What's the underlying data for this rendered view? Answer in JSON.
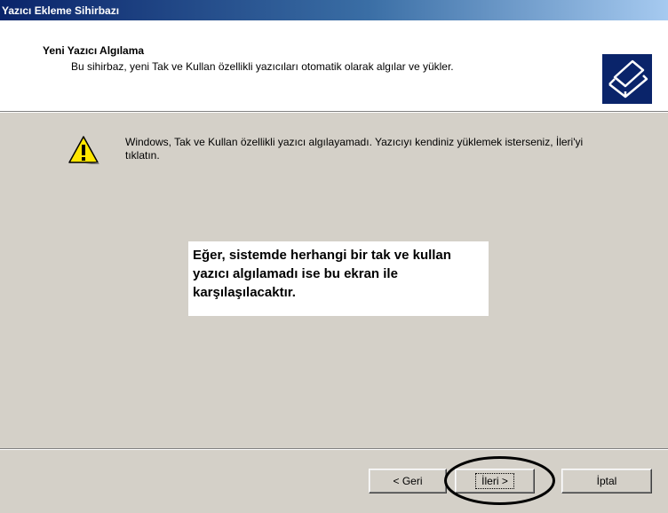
{
  "window": {
    "title": "Yazıcı Ekleme Sihirbazı"
  },
  "header": {
    "title": "Yeni Yazıcı Algılama",
    "subtitle": "Bu sihirbaz, yeni Tak ve Kullan özellikli yazıcıları otomatik olarak algılar ve yükler.",
    "icon": "printer-icon"
  },
  "body": {
    "warning_icon": "warning-icon",
    "warning_text": "Windows, Tak ve Kullan özellikli yazıcı algılayamadı. Yazıcıyı kendiniz yüklemek isterseniz, İleri'yi tıklatın.",
    "annotation": "Eğer, sistemde herhangi bir tak ve kullan yazıcı algılamadı ise bu ekran ile karşılaşılacaktır."
  },
  "buttons": {
    "back": "< Geri",
    "next": "İleri >",
    "cancel": "İptal"
  }
}
